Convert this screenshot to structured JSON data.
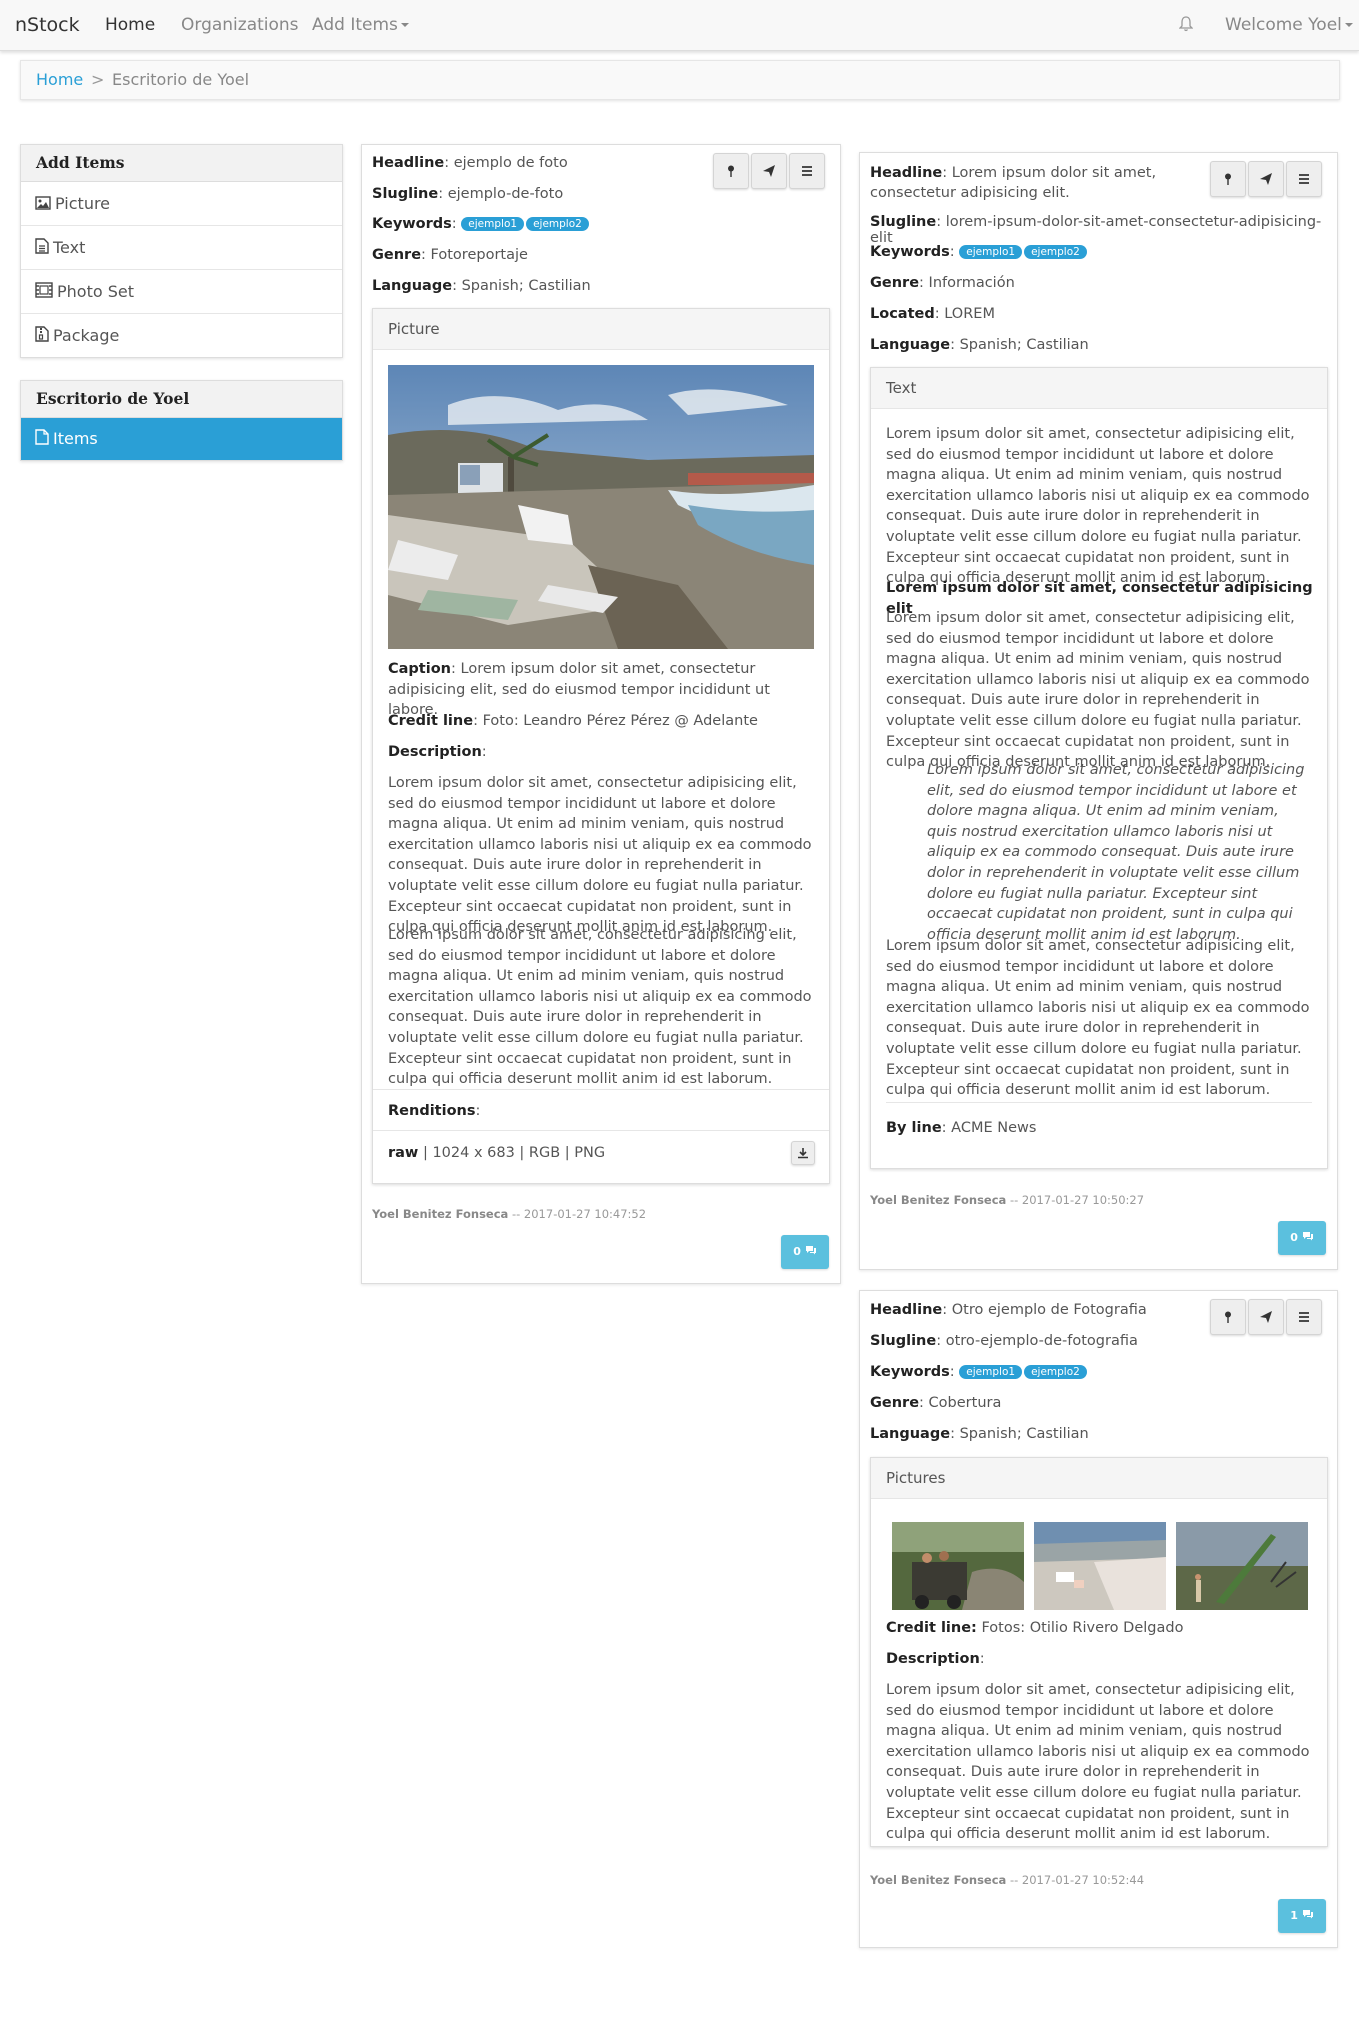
{
  "navbar": {
    "brand": "nStock",
    "home": "Home",
    "organizations": "Organizations",
    "add_items": "Add Items",
    "welcome": "Welcome Yoel"
  },
  "breadcrumb": {
    "home": "Home",
    "separator": ">",
    "current": "Escritorio de Yoel"
  },
  "sidebar": {
    "add_items_title": "Add Items",
    "add_items": [
      {
        "label": "Picture",
        "icon": "image-icon"
      },
      {
        "label": "Text",
        "icon": "file-text-icon"
      },
      {
        "label": "Photo Set",
        "icon": "film-icon"
      },
      {
        "label": "Package",
        "icon": "file-archive-icon"
      }
    ],
    "desk_title": "Escritorio de Yoel",
    "desk_items": [
      {
        "label": "Items",
        "icon": "file-icon"
      }
    ]
  },
  "labels": {
    "headline": "Headline",
    "slugline": "Slugline",
    "keywords": "Keywords",
    "genre": "Genre",
    "located": "Located",
    "language": "Language",
    "caption": "Caption",
    "credit_line": "Credit line",
    "credit_line_colon": "Credit line:",
    "description": "Description",
    "renditions": "Renditions",
    "by_line": "By line"
  },
  "lorem": "Lorem ipsum dolor sit amet, consectetur adipisicing elit, sed do eiusmod tempor incididunt ut labore et dolore magna aliqua. Ut enim ad minim veniam, quis nostrud exercitation ullamco laboris nisi ut aliquip ex ea commodo consequat. Duis aute irure dolor in reprehenderit in voluptate velit esse cillum dolore eu fugiat nulla pariatur. Excepteur sint occaecat cupidatat non proident, sunt in culpa qui officia deserunt mollit anim id est laborum.",
  "card1": {
    "headline": "ejemplo de foto",
    "slugline": "ejemplo-de-foto",
    "keywords": [
      "ejemplo1",
      "ejemplo2"
    ],
    "genre": "Fotoreportaje",
    "language": "Spanish; Castilian",
    "section_title": "Picture",
    "caption": "Lorem ipsum dolor sit amet, consectetur adipisicing elit, sed do eiusmod tempor incididunt ut labore.",
    "credit_line": "Foto: Leandro Pérez Pérez @ Adelante",
    "rendition_name": "raw",
    "rendition_info": "| 1024 x 683 | RGB | PNG",
    "author": "Yoel Benitez Fonseca",
    "timestamp": "-- 2017-01-27 10:47:52",
    "comments": "0"
  },
  "card2": {
    "headline": "Lorem ipsum dolor sit amet, consectetur adipisicing elit.",
    "slugline": "lorem-ipsum-dolor-sit-amet-consectetur-adipisicing-elit",
    "keywords": [
      "ejemplo1",
      "ejemplo2"
    ],
    "genre": "Información",
    "located": "LOREM",
    "language": "Spanish; Castilian",
    "section_title": "Text",
    "subheading": "Lorem ipsum dolor sit amet, consectetur adipisicing elit",
    "by_line": "ACME News",
    "author": "Yoel Benitez Fonseca",
    "timestamp": "-- 2017-01-27 10:50:27",
    "comments": "0"
  },
  "card3": {
    "headline": "Otro ejemplo de Fotografia",
    "slugline": "otro-ejemplo-de-fotografia",
    "keywords": [
      "ejemplo1",
      "ejemplo2"
    ],
    "genre": "Cobertura",
    "language": "Spanish; Castilian",
    "section_title": "Pictures",
    "credit_line": "Fotos: Otilio Rivero Delgado",
    "author": "Yoel Benitez Fonseca",
    "timestamp": "-- 2017-01-27 10:52:44",
    "comments": "1"
  },
  "colors": {
    "accent": "#2a9fd6",
    "info": "#5bc0de",
    "navbar": "#f8f8f8"
  }
}
